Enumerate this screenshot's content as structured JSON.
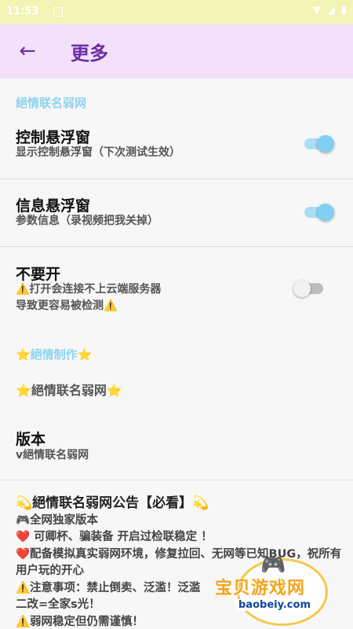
{
  "status": {
    "time": "11:53"
  },
  "appbar": {
    "back_icon": "arrow-left-icon",
    "title": "更多"
  },
  "sections": {
    "cat1": "絕情联名弱网",
    "float_window": {
      "title": "控制悬浮窗",
      "subtitle": "显示控制悬浮窗（下次测试生效）",
      "enabled": true
    },
    "info_window": {
      "title": "信息悬浮窗",
      "subtitle": "参数信息（录视频把我关掉）",
      "enabled": true
    },
    "dont_open": {
      "title": "不要开",
      "line1": "⚠️打开会连接不上云端服务器",
      "line2": "导致更容易被检测⚠️",
      "enabled": false
    },
    "cat2": "⭐絕情制作⭐",
    "credit": "⭐絕情联名弱网⭐",
    "version": {
      "title": "版本",
      "value": "v絕情联名弱网"
    }
  },
  "notice": {
    "title": "💫絕情联名弱网公告【必看】💫",
    "lines": [
      "🎮全网独家版本",
      "❤️ 可卿杯、骗装备 开启过检联稳定 ！",
      "❤️配备模拟真实弱网环境，修复拉回、无网等已知BUG，祝所有用户玩的开心",
      "⚠️注意事项：禁止倒卖、泛滥！泛滥",
      "二改=全家s光！",
      "⚠️弱网稳定但仍需谨慎！"
    ]
  },
  "watermark": {
    "text": "宝贝游戏网",
    "url": "baobeiy.com"
  },
  "colors": {
    "accent": "#6b2fa3",
    "appbar_bg": "#f3e1fb",
    "switch_on": "#7fd0f2",
    "category": "#8fd3f0"
  }
}
